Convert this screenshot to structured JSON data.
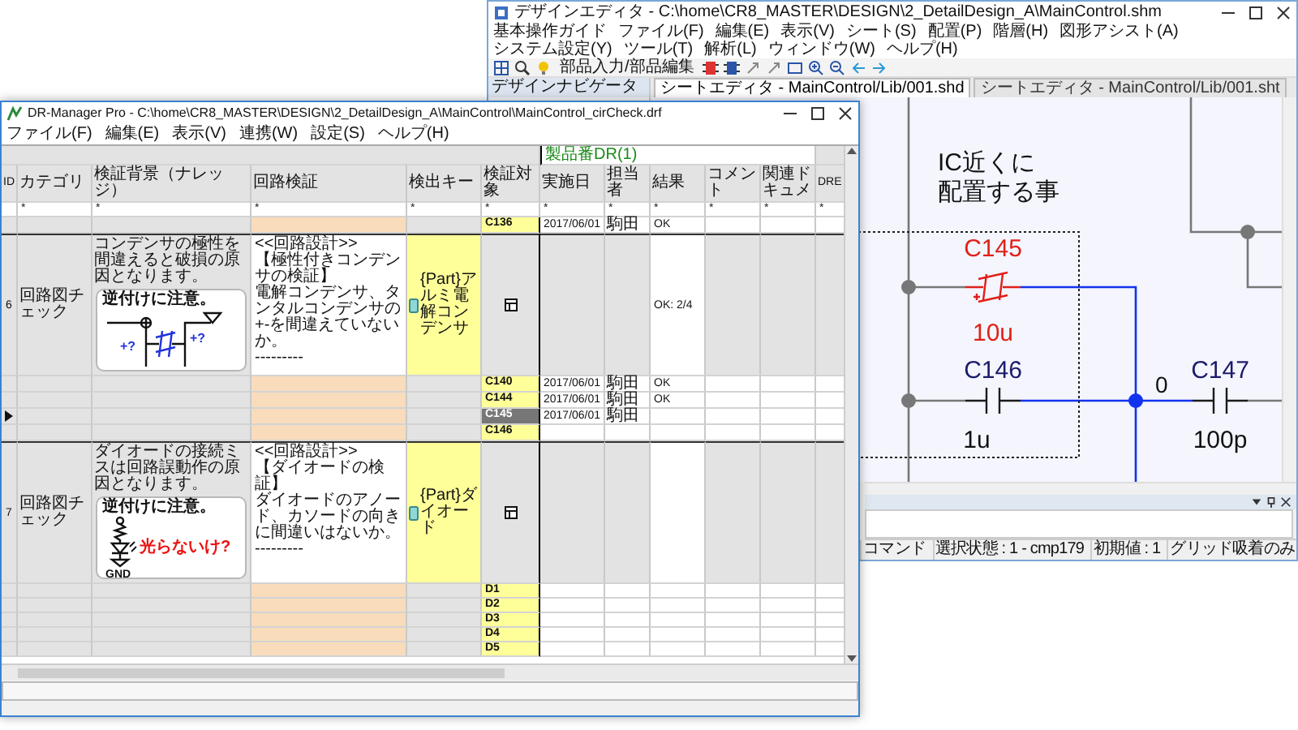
{
  "design_editor": {
    "title": "デザインエディタ - C:\\home\\CR8_MASTER\\DESIGN\\2_DetailDesign_A\\MainControl.shm",
    "menu": [
      "基本操作ガイド",
      "ファイル(F)",
      "編集(E)",
      "表示(V)",
      "シート(S)",
      "配置(P)",
      "階層(H)",
      "図形アシスト(A)",
      "システム設定(Y)",
      "ツール(T)",
      "解析(L)",
      "ウィンドウ(W)",
      "ヘルプ(H)"
    ],
    "toolbar_button": "部品入力/部品編集",
    "navigator": {
      "label": "デザインナビゲータ"
    },
    "tabs": [
      {
        "label": "シートエディタ - MainControl/Lib/001.shd",
        "selected": true
      },
      {
        "label": "シートエディタ - MainControl/Lib/001.sht",
        "selected": false
      }
    ],
    "canvas": {
      "note_lines": [
        "IC近くに",
        "配置する事"
      ],
      "net_label": "0",
      "parts": [
        {
          "ref": "C145",
          "value": "10u",
          "kind": "polarized",
          "selected": true
        },
        {
          "ref": "C146",
          "value": "1u",
          "kind": "capacitor",
          "selected": false
        },
        {
          "ref": "C147",
          "value": "100p",
          "kind": "capacitor",
          "selected": false
        }
      ]
    },
    "status_bar": [
      "コマンド",
      "選択状態 : 1 - cmp179",
      "初期値 : 1",
      "グリッド吸着のみ"
    ]
  },
  "dr_manager": {
    "title": "DR-Manager Pro - C:\\home\\CR8_MASTER\\DESIGN\\2_DetailDesign_A\\MainControl\\MainControl_cirCheck.drf",
    "menu": [
      "ファイル(F)",
      "編集(E)",
      "表示(V)",
      "連携(W)",
      "設定(S)",
      "ヘルプ(H)"
    ],
    "group_header": "製品番DR(1)",
    "columns": [
      {
        "label": "ID"
      },
      {
        "label": "カテゴリ",
        "filter": "*"
      },
      {
        "label": "検証背景（ナレッジ）",
        "filter": "*"
      },
      {
        "label": "回路検証",
        "filter": "*"
      },
      {
        "label": "検出キー",
        "filter": "*"
      },
      {
        "label": "検証対象",
        "filter": "*"
      },
      {
        "label": "実施日",
        "filter": "*"
      },
      {
        "label": "担当者",
        "filter": "*"
      },
      {
        "label": "結果",
        "filter": "*"
      },
      {
        "label": "コメント",
        "filter": "*"
      },
      {
        "label": "関連ドキュメ",
        "filter": "*"
      },
      {
        "label": "DRE",
        "filter": "*"
      }
    ],
    "leading_targets": [
      {
        "name": "C136",
        "date": "2017/06/01",
        "person": "駒田",
        "result": "OK",
        "selected": false
      }
    ],
    "items": [
      {
        "id": "6",
        "category": "回路図チェック",
        "background": "コンデンサの極性を間違えると破損の原因となります。",
        "card": {
          "kind": "capacitor",
          "title": "逆付けに注意。",
          "labels": [
            "+?",
            "+?"
          ]
        },
        "verification_lines": [
          "<<回路設計>>",
          "【極性付きコンデンサの検証】",
          "電解コンデンサ、タンタルコンデンサの+-を間違えていないか。",
          "---------"
        ],
        "key": "{Part}アルミ電解コンデンサ",
        "result": "OK: 2/4",
        "targets": [
          {
            "name": "C140",
            "date": "2017/06/01",
            "person": "駒田",
            "result": "OK",
            "selected": false
          },
          {
            "name": "C144",
            "date": "2017/06/01",
            "person": "駒田",
            "result": "OK",
            "selected": false
          },
          {
            "name": "C145",
            "date": "2017/06/01",
            "person": "駒田",
            "selected": true
          },
          {
            "name": "C146",
            "selected": false
          }
        ]
      },
      {
        "id": "7",
        "category": "回路図チェック",
        "background": "ダイオードの接続ミスは回路誤動作の原因となります。",
        "card": {
          "kind": "diode",
          "title": "逆付けに注意。",
          "labels": [
            "光らないけ?",
            "GND"
          ]
        },
        "verification_lines": [
          "<<回路設計>>",
          "【ダイオードの検証】",
          "ダイオードのアノード、カソードの向きに間違いはないか。",
          "---------"
        ],
        "key": "{Part}ダイオード",
        "targets": [
          {
            "name": "D1",
            "selected": false
          },
          {
            "name": "D2",
            "selected": false
          },
          {
            "name": "D3",
            "selected": false
          },
          {
            "name": "D4",
            "selected": false
          },
          {
            "name": "D5",
            "selected": false
          }
        ]
      }
    ]
  }
}
